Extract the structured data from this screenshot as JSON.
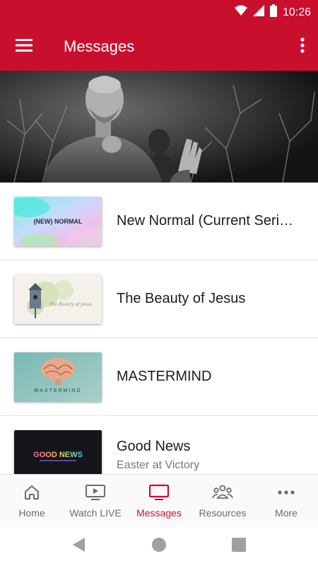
{
  "status_bar": {
    "time": "10:26",
    "icons": [
      "wifi-icon",
      "cell-signal-icon",
      "battery-icon"
    ]
  },
  "app_bar": {
    "title": "Messages",
    "icons": [
      "hamburger-menu-icon",
      "more-vertical-icon"
    ]
  },
  "hero": {
    "description_icon": "speaker-photo"
  },
  "series": [
    {
      "title": "New Normal (Current Seri…",
      "subtitle": "",
      "thumb_text": "(NEW) NORMAL"
    },
    {
      "title": "The Beauty of Jesus",
      "subtitle": "",
      "thumb_text": "The Beauty of Jesus"
    },
    {
      "title": "MASTERMIND",
      "subtitle": "",
      "thumb_text": "MASTERMIND"
    },
    {
      "title": "Good News",
      "subtitle": "Easter at Victory",
      "thumb_text": "GOOD NEWS"
    }
  ],
  "bottom_nav": [
    {
      "label": "Home",
      "icon": "home-icon",
      "active": false
    },
    {
      "label": "Watch LIVE",
      "icon": "tv-play-icon",
      "active": false
    },
    {
      "label": "Messages",
      "icon": "tv-icon",
      "active": true
    },
    {
      "label": "Resources",
      "icon": "people-icon",
      "active": false
    },
    {
      "label": "More",
      "icon": "more-horizontal-icon",
      "active": false
    }
  ],
  "system_nav": [
    "back-icon",
    "home-circle-icon",
    "recents-icon"
  ],
  "colors": {
    "brand": "#c8102e",
    "nav_inactive": "#6d6d6d",
    "divider": "#e4e4e4"
  }
}
